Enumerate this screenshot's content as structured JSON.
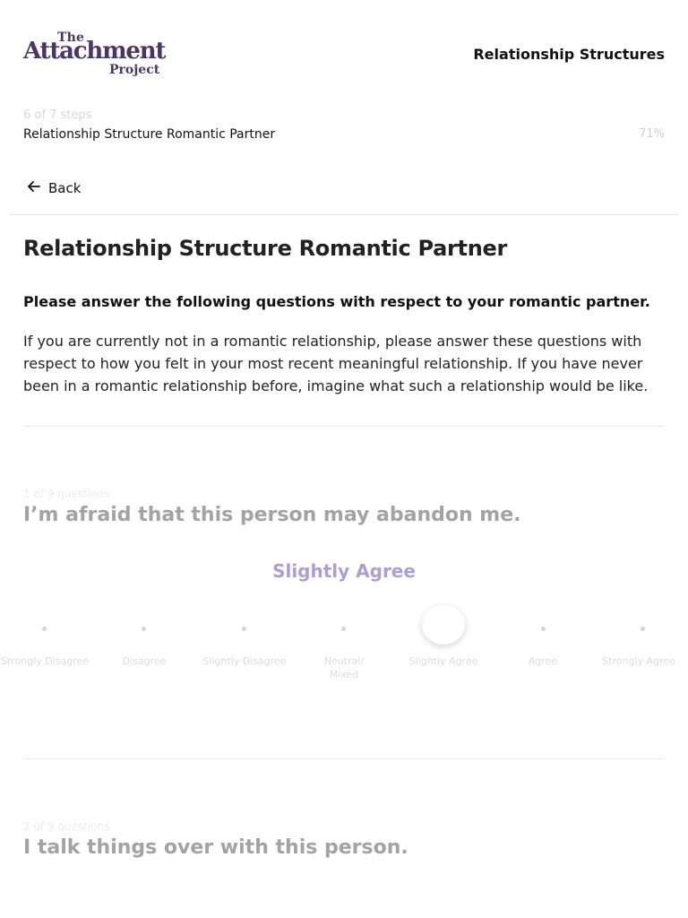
{
  "header": {
    "logo": {
      "the": "The",
      "main": "Attachment",
      "project": "Project"
    },
    "title": "Relationship Structures"
  },
  "progress": {
    "steps_text": "6 of 7 steps",
    "step_name": "Relationship Structure Romantic Partner",
    "percent_text": "71%",
    "value": 0.71
  },
  "nav": {
    "back_label": "Back"
  },
  "section": {
    "title": "Relationship Structure Romantic Partner",
    "instruction_bold": "Please answer the following questions with respect to your romantic partner.",
    "instruction": "If you are currently not in a romantic relationship, please answer these questions with respect to how you felt in your most recent meaningful relationship. If you have never been in a romantic relationship before, imagine what such a relationship would be like."
  },
  "questions": [
    {
      "count": "1 of 9 questions",
      "text": "I’m afraid that this person may abandon me.",
      "selected_label": "Slightly Agree",
      "selected_index": 4
    },
    {
      "count": "2 of 9 questions",
      "text": "I talk things over with this person."
    }
  ],
  "scale": {
    "labels": [
      "Strongly Disagree",
      "Disagree",
      "Slightly Disagree",
      "Neutral/ Mixed",
      "Slightly Agree",
      "Agree",
      "Strongly Agree"
    ]
  },
  "colors": {
    "brand": "#4b3563",
    "selected_label": "#ab9fd1",
    "question_text": "#a3a3a3"
  }
}
